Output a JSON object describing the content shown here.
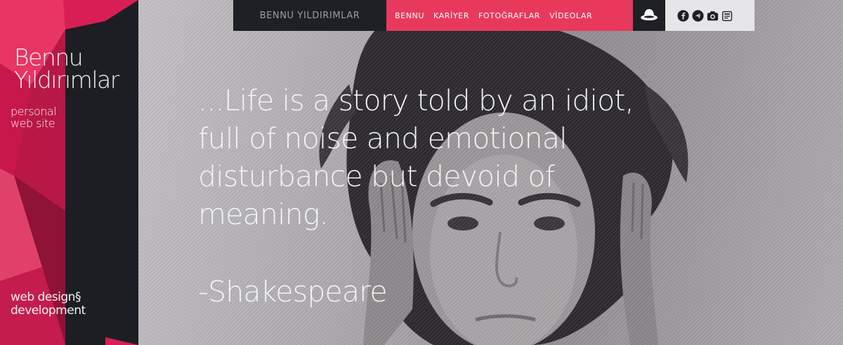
{
  "sidebar": {
    "title_line1": "Bennu",
    "title_line2": "Yıldırımlar",
    "subtitle_line1": "personal",
    "subtitle_line2": "web site",
    "footer_line1": "web design§",
    "footer_line2": "development"
  },
  "nav": {
    "site_name": "BENNU YILDIRIMLAR",
    "items": [
      {
        "label": "BENNU"
      },
      {
        "label": "KARİYER"
      },
      {
        "label": "FOTOĞRAFLAR"
      },
      {
        "label": "VİDEOLAR"
      }
    ],
    "social_icons": [
      "facebook-icon",
      "twitter-icon",
      "camera-icon",
      "blog-icon"
    ],
    "hat_icon": "hat-icon"
  },
  "hero": {
    "quote_lines": [
      "...Life is a story told by an idiot,",
      "full of noise and emotional",
      "disturbance but devoid of",
      "meaning."
    ],
    "author": "-Shakespeare"
  },
  "colors": {
    "accent": "#e8395d",
    "dark": "#1f2026",
    "light": "#e6e6e8"
  }
}
